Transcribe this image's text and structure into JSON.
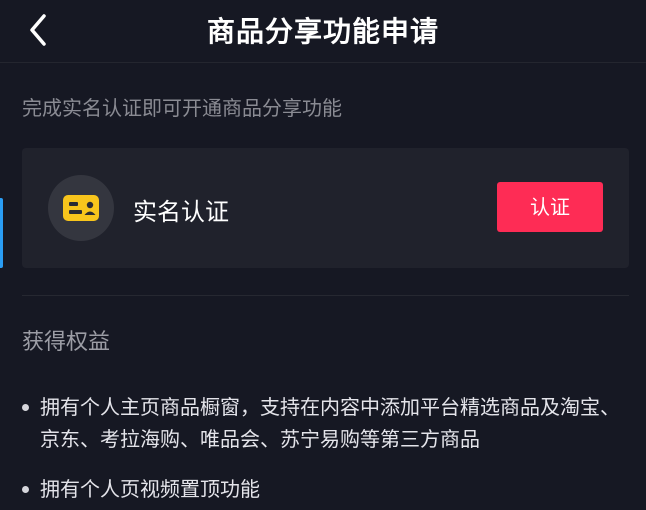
{
  "header": {
    "title": "商品分享功能申请",
    "back_icon": "chevron-left-icon"
  },
  "intro": {
    "text": "完成实名认证即可开通商品分享功能"
  },
  "verification_card": {
    "icon": "id-card-icon",
    "label": "实名认证",
    "button_label": "认证",
    "button_color": "#fe2c55"
  },
  "benefits": {
    "title": "获得权益",
    "items": [
      {
        "text": "拥有个人主页商品橱窗，支持在内容中添加平台精选商品及淘宝、京东、考拉海购、唯品会、苏宁易购等第三方商品"
      },
      {
        "text": "拥有个人页视频置顶功能"
      }
    ]
  },
  "colors": {
    "background": "#161823",
    "card_background": "#20222c",
    "accent": "#fe2c55",
    "icon_yellow": "#f8c51c"
  }
}
